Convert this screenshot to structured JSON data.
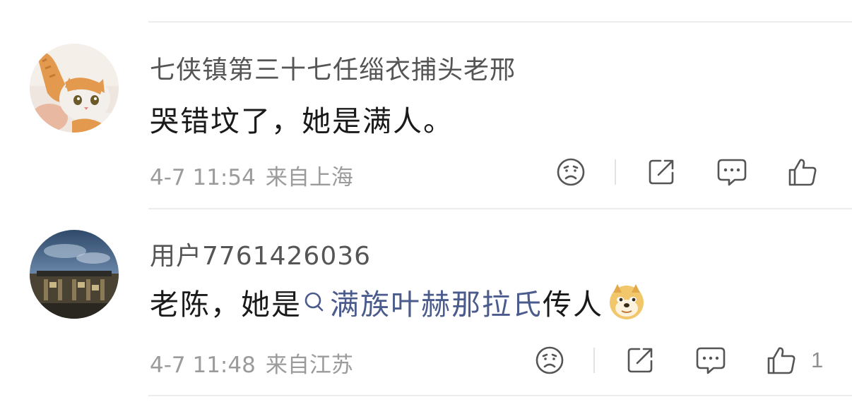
{
  "comments": [
    {
      "username": "七侠镇第三十七任缁衣捕头老邢",
      "text": "哭错坟了，她是满人。",
      "time": "4-7 11:54",
      "location": "来自上海",
      "like_count": "",
      "avatar": "cat-photo"
    },
    {
      "username": "用户7761426036",
      "text_before": "老陈，她是",
      "topic": "满族叶赫那拉氏",
      "text_after": "传人",
      "emoji": "doge-emoji",
      "time": "4-7 11:48",
      "location": "来自江苏",
      "like_count": "1",
      "avatar": "mall-interior-photo"
    }
  ],
  "icons": [
    "sad-face-icon",
    "share-icon",
    "comment-icon",
    "thumbs-up-icon",
    "search-icon"
  ],
  "colors": {
    "username": "#555555",
    "text": "#1a1a1a",
    "meta": "#9b9b9b",
    "topic_link": "#4a5b8c",
    "icon": "#555555",
    "divider": "#ececec"
  }
}
